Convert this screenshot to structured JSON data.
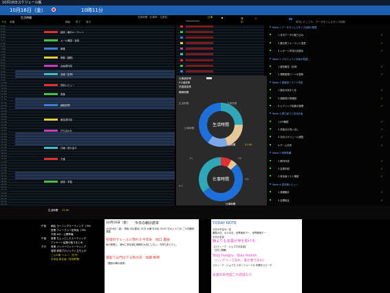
{
  "titlebar": {
    "title": "10月16日スケジュール帳"
  },
  "topbar": {
    "date": "10月16日（金）",
    "time": "10時11分"
  },
  "header": {
    "left_title": "生活時間",
    "mid_title": "充実時間（仕事率・生産性）",
    "work_label": "仕事",
    "stats_title": "仕事進捗状況",
    "right_title": "気付いたことや、データタイムスタンプ記録",
    "col_labels": [
      "予定",
      "実績",
      "開始",
      "終了",
      "差分"
    ]
  },
  "right_header_marks": [
    "済",
    "中",
    "未"
  ],
  "colors": {
    "accent_blue": "#1c5fae",
    "pink": "#e03ab8",
    "red": "#e03030",
    "yellow": "#e4d13a",
    "donut_teal": "#2fa7b8",
    "donut_blue": "#1e6fd9"
  },
  "grid": {
    "times": [
      "5:00",
      "5:15",
      "5:30",
      "5:45",
      "6:00",
      "6:15",
      "6:30",
      "6:45",
      "7:00",
      "7:15",
      "7:30",
      "7:45",
      "8:00",
      "8:15",
      "8:30",
      "8:45",
      "9:00",
      "9:15",
      "9:30",
      "9:45",
      "10:00",
      "10:15",
      "10:30",
      "10:45",
      "11:00",
      "11:15",
      "11:30",
      "11:45",
      "12:00",
      "12:15",
      "12:30",
      "12:45",
      "13:00",
      "13:15",
      "13:30",
      "13:45",
      "14:00",
      "14:15",
      "14:30",
      "14:45",
      "15:00",
      "15:15",
      "15:30",
      "15:45",
      "16:00",
      "16:15",
      "16:30",
      "16:45",
      "17:00",
      "17:15",
      "17:30",
      "17:45",
      "18:00",
      "18:15",
      "18:30",
      "18:45",
      "19:00",
      "19:15",
      "19:30",
      "19:45",
      "20:00",
      "20:15",
      "20:30",
      "20:45"
    ],
    "entries": [
      {
        "label": "起床・朝のルーティン"
      },
      {
        "label": "メール確認・返信"
      },
      {
        "label": "朝食"
      },
      {
        "label": "移動（通勤）"
      },
      {
        "label": "企画書作成"
      },
      {
        "label": "会議（定例）"
      },
      {
        "label": "資料レビュー"
      },
      {
        "label": "昼食"
      },
      {
        "label": "顧客訪問"
      },
      {
        "label": "報告書作成"
      },
      {
        "label": "打ち合わせ"
      },
      {
        "label": "日報・振り返り"
      },
      {
        "label": "夕食"
      },
      {
        "label": "読書・学習"
      }
    ],
    "footer_label": "生活時間",
    "footer_value": "21:00"
  },
  "side_stats": {
    "labels": [
      "仕事進捗率",
      "P.D達成率",
      "学習達成率",
      "睡眠時間"
    ],
    "values": [
      "",
      "",
      "",
      ""
    ]
  },
  "donut1": {
    "title": "生活時間",
    "labels": [
      "生活時間",
      "充実時間",
      "仕事時間"
    ],
    "summary_label": "生活時間",
    "summary_value": "21:00"
  },
  "donut2": {
    "title": "仕事時間",
    "labels": [
      "P.J.",
      "OE",
      "AD.",
      "R.F."
    ],
    "summary_label": "仕事時間"
  },
  "chart_data": [
    {
      "type": "pie",
      "title": "生活時間",
      "categories": [
        "睡眠",
        "生活",
        "充実",
        "仕事"
      ],
      "values": [
        25,
        20,
        15,
        40
      ]
    },
    {
      "type": "pie",
      "title": "仕事時間",
      "categories": [
        "P.J.",
        "OE",
        "AD.",
        "R.F."
      ],
      "values": [
        8,
        5,
        52,
        35
      ]
    }
  ],
  "notes": {
    "items": [
      "Week 1 データタイムスタンプ記録の整理",
      "1 月次データの取り込み",
      "2 集計表フォーマット変更",
      "3 レポート作成の自動化",
      "Week 2 プロジェクト計画の見直し",
      "1 進捗報告（全体）",
      "2 課題管理シートの更新",
      "Week 3 提案書ドラフト作成",
      "1 競合分析まとめ",
      "2 価格表の再確認",
      "3 ヒアリング結果の整理",
      "Week 4 振り返りと次月計画",
      "1 KPI確認",
      "2 改善点の洗い出し",
      "3 次月スケジュール調整",
      "4 チーム共有",
      "Week 5 研修準備",
      "1 教材作成",
      "2 会場手配",
      "3 参加者リスト確認",
      "Week 6 四半期レビュー",
      "1 実績集計",
      "2 目標設定"
    ]
  },
  "bottom_left": {
    "rows": [
      {
        "time": "午前",
        "text": "朝会 モーニングミーティング（TM）"
      },
      {
        "time": "",
        "text": "営業 ウィークリー定例会（TM）"
      },
      {
        "time": "",
        "text": "予算 WG・公開準備"
      },
      {
        "time": "午後",
        "text": "営業 ちょっとしたミーティング"
      },
      {
        "time": "",
        "text": "アンケート結果の取りまとめ"
      },
      {
        "time": "夕方",
        "text": "営業 ナンバーワンミーティング"
      },
      {
        "time": "",
        "text": "運営 新規プロジェクト立ち上げ"
      },
      {
        "time": "",
        "text": "ごんの家 ヘル ニ（日中）"
      },
      {
        "time": "",
        "text": "お茶会 新企画（定刻終業）"
      }
    ]
  },
  "reading": {
    "date": "10月16日（金）",
    "title": "今日の朝の読本",
    "line1": "10月16日（金） 晴後 4月(重月) 21日 大潮 日の出 05:47 日の入 17:10 二十四節気 寒露",
    "book1": "花城のヴェールに隠れた今年末　堀口 直樹",
    "desc1": "秋の夜長に、静かに本を読む時間を大切にしたい。今年もあと少し。",
    "book2": "雷起で山門は下る秋の声　加藤 楸邨",
    "desc2": "（雑誌の朝の読本）"
  },
  "today": {
    "title": "TODAY NOTE",
    "sub": "今日の予定の一言",
    "line1": "勝負の日。ボスの日。世界食料デー、世界脊椎デー",
    "line2": "今日の名言",
    "quote1": "静よりも言葉が身を助ける",
    "src1": "【スティーブ・ジョブズの名言】",
    "src2": "（日付 /書籍）",
    "quote2": "Stay hungry , Stay foolish.",
    "quote2b": "（ハングリーであれ、愚か者であれ）",
    "author": "スティーブ・ジョブズ  スタンフォード大 卒業式スピーチ",
    "quote3": "永遠の未完成これ完成なり"
  }
}
